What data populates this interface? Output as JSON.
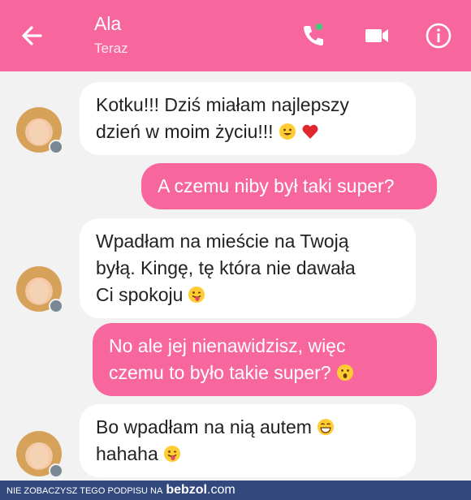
{
  "header": {
    "contact_name": "Ala",
    "status": "Teraz"
  },
  "messages": [
    {
      "line1": "Kotku!!! Dziś miałam najlepszy",
      "line2": "dzień w moim życiu!!!"
    },
    {
      "line1": "A czemu niby był taki super?"
    },
    {
      "line1": "Wpadłam na mieście na Twoją",
      "line2": "byłą. Kingę, tę która nie dawała",
      "line3": "Ci spokoju"
    },
    {
      "line1": "No ale jej nienawidzisz, więc",
      "line2": "czemu to było takie super?"
    },
    {
      "line1": "Bo wpadłam na nią autem",
      "line2": "hahaha"
    }
  ],
  "footer": {
    "caption": "NIE ZOBACZYSZ TEGO PODPISU NA",
    "brand": "bebzol",
    "brand_suffix": ".com"
  },
  "colors": {
    "accent": "#f7679e",
    "background": "#f2f2f2",
    "footer": "#33497e"
  }
}
